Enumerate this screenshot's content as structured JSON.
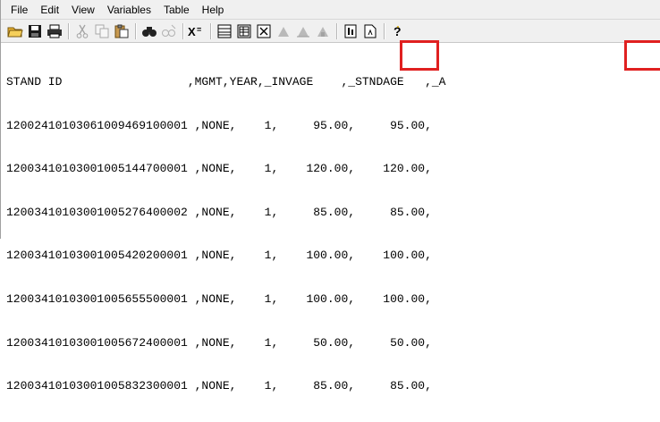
{
  "menu": [
    "File",
    "Edit",
    "View",
    "Variables",
    "Table",
    "Help"
  ],
  "toolbar": {
    "buttons": [
      {
        "name": "open-folder-icon",
        "disabled": false
      },
      {
        "name": "save-icon",
        "disabled": false
      },
      {
        "name": "print-icon",
        "disabled": false
      },
      {
        "sep": true
      },
      {
        "name": "cut-icon",
        "disabled": true
      },
      {
        "name": "copy-icon",
        "disabled": true
      },
      {
        "name": "paste-icon",
        "disabled": false
      },
      {
        "sep": true
      },
      {
        "name": "find-icon",
        "disabled": false
      },
      {
        "name": "replace-icon",
        "disabled": true
      },
      {
        "sep": true
      },
      {
        "name": "variable-icon",
        "disabled": false
      },
      {
        "sep": true
      },
      {
        "name": "table-view-icon",
        "disabled": false
      },
      {
        "name": "grid-view-icon",
        "disabled": false
      },
      {
        "name": "delete-table-icon",
        "disabled": false
      },
      {
        "name": "chart-icon-1",
        "disabled": true
      },
      {
        "name": "chart-icon-2",
        "disabled": true
      },
      {
        "name": "chart-icon-3",
        "disabled": true
      },
      {
        "sep": true
      },
      {
        "name": "report-icon",
        "disabled": false
      },
      {
        "name": "document-icon",
        "disabled": false
      },
      {
        "sep": true
      },
      {
        "name": "help-icon",
        "disabled": false
      }
    ]
  },
  "table": {
    "header": "STAND ID                  ,MGMT,YEAR,_INVAGE    ,_STNDAGE   ,_A",
    "rows": [
      "12002410103061009469100001 ,NONE,    1,     95.00,     95.00,",
      "12003410103001005144700001 ,NONE,    1,    120.00,    120.00,",
      "12003410103001005276400002 ,NONE,    1,     85.00,     85.00,",
      "12003410103001005420200001 ,NONE,    1,    100.00,    100.00,",
      "12003410103001005655500001 ,NONE,    1,    100.00,    100.00,",
      "12003410103001005672400001 ,NONE,    1,     50.00,     50.00,",
      "12003410103001005832300001 ,NONE,    1,     85.00,     85.00,"
    ]
  },
  "colors": {
    "highlight": "#e02020"
  }
}
